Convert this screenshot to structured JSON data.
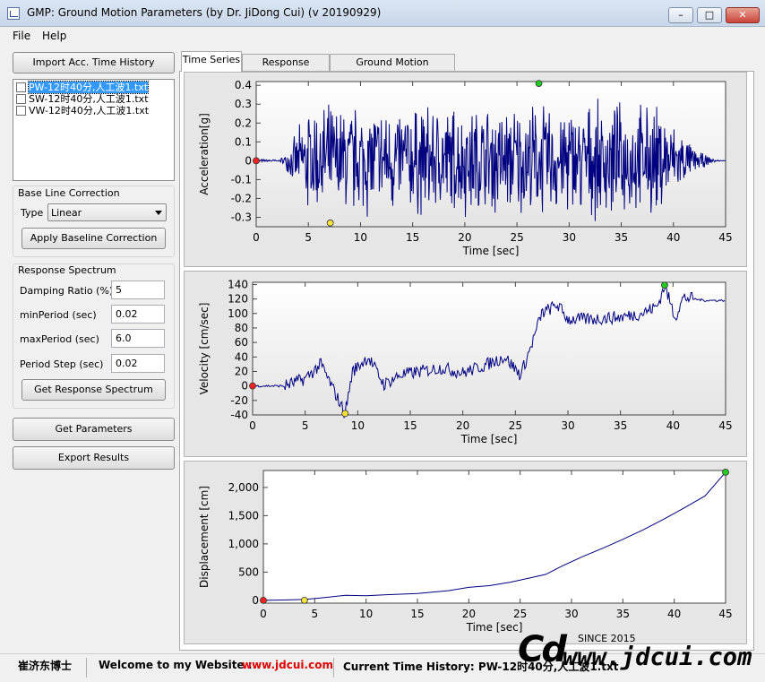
{
  "window": {
    "title": "GMP: Ground Motion Parameters (by Dr. JiDong Cui) (v 20190929)",
    "minimize": "–",
    "maximize": "□",
    "close": "✕"
  },
  "menu": {
    "file": "File",
    "help": "Help"
  },
  "left": {
    "import_button": "Import Acc. Time History",
    "files": [
      {
        "label": "PW-12时40分,人工波1.txt",
        "selected": true,
        "checked": false
      },
      {
        "label": "SW-12时40分,人工波1.txt",
        "selected": false,
        "checked": false
      },
      {
        "label": "VW-12时40分,人工波1.txt",
        "selected": false,
        "checked": false
      }
    ],
    "baseline": {
      "title": "Base Line Correction",
      "type_label": "Type",
      "type_value": "Linear",
      "apply_button": "Apply Baseline Correction"
    },
    "spectrum": {
      "title": "Response Spectrum",
      "damping_label": "Damping Ratio (%)",
      "damping_value": "5",
      "min_label": "minPeriod (sec)",
      "min_value": "0.02",
      "max_label": "maxPeriod (sec)",
      "max_value": "6.0",
      "step_label": "Period Step (sec)",
      "step_value": "0.02",
      "get_button": "Get Response Spectrum"
    },
    "get_parameters": "Get Parameters",
    "export_results": "Export Results"
  },
  "tabs": [
    {
      "label": "Time Series",
      "active": true
    },
    {
      "label": "Response Spectra",
      "active": false
    },
    {
      "label": "Ground Motion Parameters",
      "active": false
    }
  ],
  "chart_data": [
    {
      "type": "line",
      "xlabel": "Time [sec]",
      "ylabel": "Acceleration[g]",
      "xlim": [
        0,
        45
      ],
      "ylim": [
        -0.35,
        0.42
      ],
      "xticks": [
        "0",
        "5",
        "10",
        "15",
        "20",
        "25",
        "30",
        "35",
        "40",
        "45"
      ],
      "yticks": [
        "0.4",
        "0.3",
        "0.2",
        "0.1",
        "0",
        "-0.1",
        "-0.2",
        "-0.3"
      ],
      "yticks_values": [
        0.4,
        0.3,
        0.2,
        0.1,
        0,
        -0.1,
        -0.2,
        -0.3
      ],
      "line_color": "#000080",
      "envelope": {
        "start": 2.0,
        "rise_end": 5.0,
        "decay_start": 39.0,
        "end": 45.0,
        "peak_amplitude": 0.33,
        "pre_amplitude": 0.008
      },
      "markers": [
        {
          "x": 0,
          "y": 0,
          "color": "#ff2020"
        },
        {
          "x": 7.1,
          "y": -0.33,
          "color": "#f5e33a"
        },
        {
          "x": 27.1,
          "y": 0.41,
          "color": "#22cc22"
        }
      ]
    },
    {
      "type": "line",
      "xlabel": "Time [sec]",
      "ylabel": "Velocity [cm/sec]",
      "xlim": [
        0,
        45
      ],
      "ylim": [
        -40,
        143
      ],
      "xticks": [
        "0",
        "5",
        "10",
        "15",
        "20",
        "25",
        "30",
        "35",
        "40",
        "45"
      ],
      "yticks": [
        "140",
        "120",
        "100",
        "80",
        "60",
        "40",
        "20",
        "0",
        "-20",
        "-40"
      ],
      "yticks_values": [
        140,
        120,
        100,
        80,
        60,
        40,
        20,
        0,
        -20,
        -40
      ],
      "line_color": "#000080",
      "trend": {
        "x": [
          0,
          3,
          5,
          6.5,
          8.8,
          9.5,
          11,
          12.5,
          14,
          16,
          18,
          20,
          22,
          24,
          25.5,
          26.5,
          27.5,
          29,
          30,
          32,
          35,
          37,
          38.5,
          39.2,
          40.2,
          41,
          43,
          45
        ],
        "y": [
          0,
          0,
          10,
          30,
          -38,
          20,
          40,
          2,
          15,
          20,
          25,
          18,
          28,
          40,
          15,
          55,
          100,
          112,
          92,
          92,
          95,
          100,
          110,
          138,
          95,
          122,
          118,
          118
        ]
      },
      "markers": [
        {
          "x": 0,
          "y": 0,
          "color": "#ff2020"
        },
        {
          "x": 8.8,
          "y": -38,
          "color": "#f5e33a"
        },
        {
          "x": 39.2,
          "y": 139,
          "color": "#22cc22"
        }
      ]
    },
    {
      "type": "line",
      "xlabel": "Time [sec]",
      "ylabel": "Displacement [cm]",
      "xlim": [
        0,
        45
      ],
      "ylim": [
        -50,
        2300
      ],
      "xticks": [
        "0",
        "5",
        "10",
        "15",
        "20",
        "25",
        "30",
        "35",
        "40",
        "45"
      ],
      "yticks": [
        "2,000",
        "1,500",
        "1,000",
        "500",
        "0"
      ],
      "yticks_values": [
        2000,
        1500,
        1000,
        500,
        0
      ],
      "line_color": "#000080",
      "x": [
        0,
        2,
        4,
        6,
        8,
        10,
        12,
        15,
        18,
        20,
        22,
        24,
        26,
        27.5,
        29,
        31,
        33,
        35,
        37,
        39,
        41,
        43,
        45
      ],
      "y": [
        0,
        5,
        15,
        50,
        90,
        80,
        100,
        120,
        170,
        230,
        260,
        320,
        400,
        460,
        600,
        770,
        920,
        1080,
        1250,
        1440,
        1640,
        1850,
        2270
      ],
      "markers": [
        {
          "x": 0,
          "y": 0,
          "color": "#ff2020"
        },
        {
          "x": 4,
          "y": 0,
          "color": "#f5e33a"
        },
        {
          "x": 45,
          "y": 2270,
          "color": "#22cc22"
        }
      ]
    }
  ],
  "status": {
    "author": "崔济东博士",
    "welcome": "Welcome to my Website :",
    "website": "www.jdcui.com",
    "current": "Current Time History: PW-12时40分,人工波1.txt"
  },
  "logo": {
    "cd": "Cd",
    "since": "SINCE 2015",
    "url": "www.jdcui.com"
  }
}
